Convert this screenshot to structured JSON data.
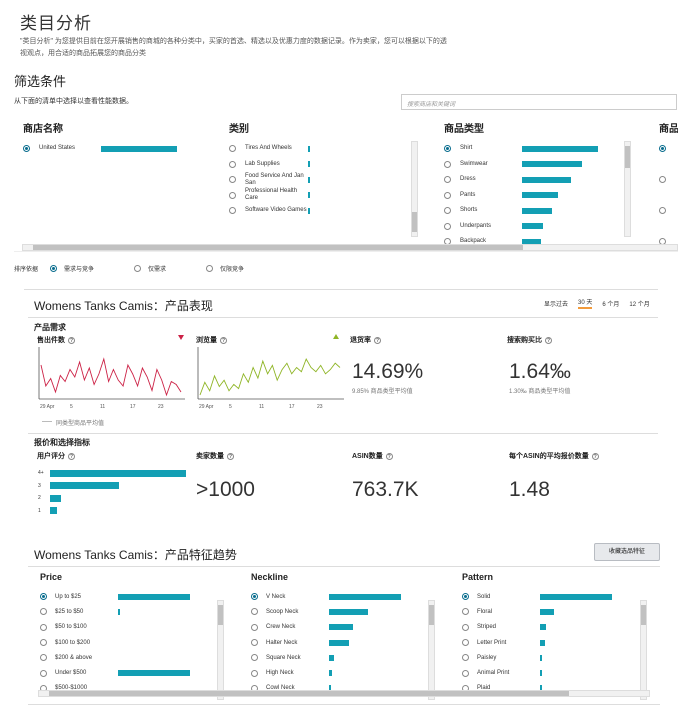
{
  "header": {
    "title": "类目分析",
    "description": "\"类目分析\" 为您提供目前在您开展销售的商城的各种分类中，买家的首选、精选以及优惠力度的数据记录。作为卖家，您可以根据以下的透视观点，用合适的商品拓展您的商品分类"
  },
  "filters": {
    "title": "筛选条件",
    "subtitle": "从下面的清单中选择以查看性能数据。",
    "search_placeholder": "搜索商店和关键词",
    "store": {
      "header": "商店名称",
      "items": [
        {
          "label": "United States",
          "value": 1.0,
          "selected": true
        }
      ]
    },
    "category": {
      "header": "类别",
      "items": [
        {
          "label": "Tires And Wheels",
          "value": 0.02
        },
        {
          "label": "Lab Supplies",
          "value": 0.02
        },
        {
          "label": "Food Service And Jan San",
          "value": 0.02
        },
        {
          "label": "Professional Health Care",
          "value": 0.02
        },
        {
          "label": "Software Video Games",
          "value": 0.02
        }
      ]
    },
    "product_type": {
      "header": "商品类型",
      "items": [
        {
          "label": "Shirt",
          "value": 1.0,
          "selected": true
        },
        {
          "label": "Swimwear",
          "value": 0.79
        },
        {
          "label": "Dress",
          "value": 0.64
        },
        {
          "label": "Pants",
          "value": 0.48
        },
        {
          "label": "Shorts",
          "value": 0.39
        },
        {
          "label": "Underpants",
          "value": 0.27
        },
        {
          "label": "Backpack",
          "value": 0.25
        }
      ]
    },
    "fourth_header": "商品"
  },
  "sort": {
    "label": "排序依据",
    "options": [
      {
        "label": "需求与竞争",
        "selected": true
      },
      {
        "label": "仅需求",
        "selected": false
      },
      {
        "label": "仅限竞争",
        "selected": false
      }
    ]
  },
  "performance": {
    "title": "Womens Tanks Camis：产品表现",
    "period_label": "显示过去",
    "periods": [
      "30 天",
      "6 个月",
      "12 个月"
    ],
    "active_period": "30 天",
    "demand_title": "产品需求",
    "units_sold": {
      "label": "售出件数",
      "values": [
        58,
        44,
        49,
        40,
        51,
        47,
        55,
        50,
        60,
        48,
        56,
        45,
        52,
        62,
        47,
        55,
        48,
        44,
        58,
        52,
        44,
        56,
        50,
        41,
        55,
        48,
        38,
        47,
        45,
        40
      ]
    },
    "page_views": {
      "label": "浏览量",
      "values": [
        32,
        44,
        36,
        50,
        40,
        46,
        36,
        42,
        38,
        52,
        44,
        58,
        48,
        64,
        52,
        60,
        46,
        56,
        62,
        52,
        58,
        54,
        66,
        58,
        54,
        60,
        52,
        56,
        62,
        58
      ]
    },
    "x_ticks": [
      "29 Apr",
      "5",
      "11",
      "17",
      "23"
    ],
    "return_rate": {
      "label": "退货率",
      "value": "14.69%",
      "sub": "9.85% 商品类型平均值"
    },
    "search_to_purchase": {
      "label": "搜索购买比",
      "value": "1.64‰",
      "sub": "1.30‰ 商品类型平均值"
    },
    "legend_avg": "同类型商品平均值",
    "offer_title": "报价和选择指标",
    "rating": {
      "label": "用户评分",
      "rows": [
        {
          "label": "4+",
          "value": 1.0
        },
        {
          "label": "3",
          "value": 0.51
        },
        {
          "label": "2",
          "value": 0.08
        },
        {
          "label": "1",
          "value": 0.05
        }
      ]
    },
    "sellers": {
      "label": "卖家数量",
      "value": ">1000"
    },
    "asins": {
      "label": "ASIN数量",
      "value": "763.7K"
    },
    "offers_per_asin": {
      "label": "每个ASIN的平均报价数量",
      "value": "1.48"
    }
  },
  "trends": {
    "title": "Womens Tanks Camis：产品特征趋势",
    "save_button": "收藏选品特征",
    "columns": [
      {
        "header": "Price",
        "items": [
          {
            "label": "Up to $25",
            "value": 1.0,
            "selected": true
          },
          {
            "label": "$25 to $50",
            "value": 0.02
          },
          {
            "label": "$50 to $100",
            "value": 0.0
          },
          {
            "label": "$100 to $200",
            "value": 0.0
          },
          {
            "label": "$200 & above",
            "value": 0.0
          },
          {
            "label": "Under $500",
            "value": 1.0
          },
          {
            "label": "$500-$1000",
            "value": 0.0
          }
        ]
      },
      {
        "header": "Neckline",
        "items": [
          {
            "label": "V Neck",
            "value": 1.0,
            "selected": true
          },
          {
            "label": "Scoop Neck",
            "value": 0.54
          },
          {
            "label": "Crew Neck",
            "value": 0.34
          },
          {
            "label": "Halter Neck",
            "value": 0.28
          },
          {
            "label": "Square Neck",
            "value": 0.07
          },
          {
            "label": "High Neck",
            "value": 0.04
          },
          {
            "label": "Cowl Neck",
            "value": 0.03
          }
        ]
      },
      {
        "header": "Pattern",
        "items": [
          {
            "label": "Solid",
            "value": 1.0,
            "selected": true
          },
          {
            "label": "Floral",
            "value": 0.19
          },
          {
            "label": "Striped",
            "value": 0.09
          },
          {
            "label": "Letter Print",
            "value": 0.07
          },
          {
            "label": "Paisley",
            "value": 0.03
          },
          {
            "label": "Animal Print",
            "value": 0.02
          },
          {
            "label": "Plaid",
            "value": 0.02
          }
        ]
      }
    ]
  },
  "colors": {
    "accent": "#139fb4",
    "red_line": "#cc2246",
    "green_line": "#8fb526",
    "radio": "#0a6d8e"
  }
}
